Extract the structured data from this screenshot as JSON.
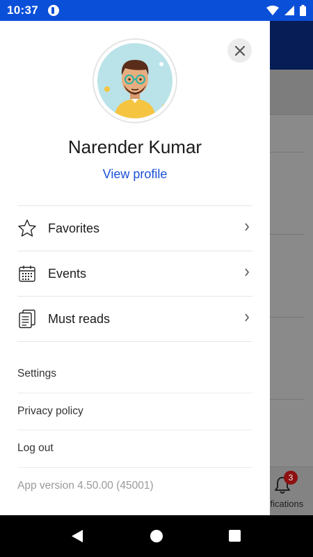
{
  "status_bar": {
    "time": "10:37"
  },
  "drawer": {
    "profile_name": "Narender Kumar",
    "view_profile": "View profile",
    "menu": [
      {
        "label": "Favorites",
        "icon": "star-icon"
      },
      {
        "label": "Events",
        "icon": "calendar-icon"
      },
      {
        "label": "Must reads",
        "icon": "document-icon"
      }
    ],
    "links": [
      {
        "label": "Settings"
      },
      {
        "label": "Privacy policy"
      },
      {
        "label": "Log out"
      }
    ],
    "app_version": "App version 4.50.00 (45001)"
  },
  "background": {
    "notifications": {
      "label": "tifications",
      "badge": "3"
    }
  },
  "colors": {
    "accent": "#1a4fd6",
    "status_bar": "#0a4fd8",
    "badge": "#8e1010"
  }
}
